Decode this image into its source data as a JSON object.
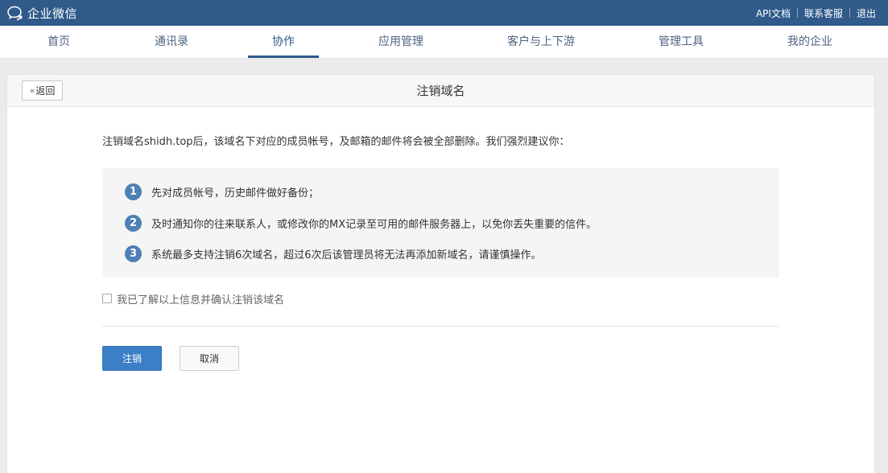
{
  "topbar": {
    "brand": "企业微信",
    "links": [
      "API文档",
      "联系客服",
      "退出"
    ],
    "background": "#2f5a8a"
  },
  "nav": {
    "items": [
      "首页",
      "通讯录",
      "协作",
      "应用管理",
      "客户与上下游",
      "管理工具",
      "我的企业"
    ],
    "active": "协作"
  },
  "panel": {
    "back_label": "返回",
    "title": "注销域名",
    "intro": "注销域名shidh.top后，该域名下对应的成员帐号，及邮箱的邮件将会被全部删除。我们强烈建议你：",
    "tips": [
      {
        "num": "1",
        "text": "先对成员帐号，历史邮件做好备份；"
      },
      {
        "num": "2",
        "text": "及时通知你的往来联系人，或修改你的MX记录至可用的邮件服务器上，以免你丢失重要的信件。"
      },
      {
        "num": "3",
        "text": "系统最多支持注销6次域名，超过6次后该管理员将无法再添加新域名，请谨慎操作。"
      }
    ],
    "confirm_label": "我已了解以上信息并确认注销该域名",
    "confirm_checked": false,
    "submit_label": "注销",
    "cancel_label": "取消"
  },
  "colors": {
    "accent": "#2f5a8a",
    "primary_button": "#3d7fc6",
    "tip_number": "#4e7fb5"
  }
}
